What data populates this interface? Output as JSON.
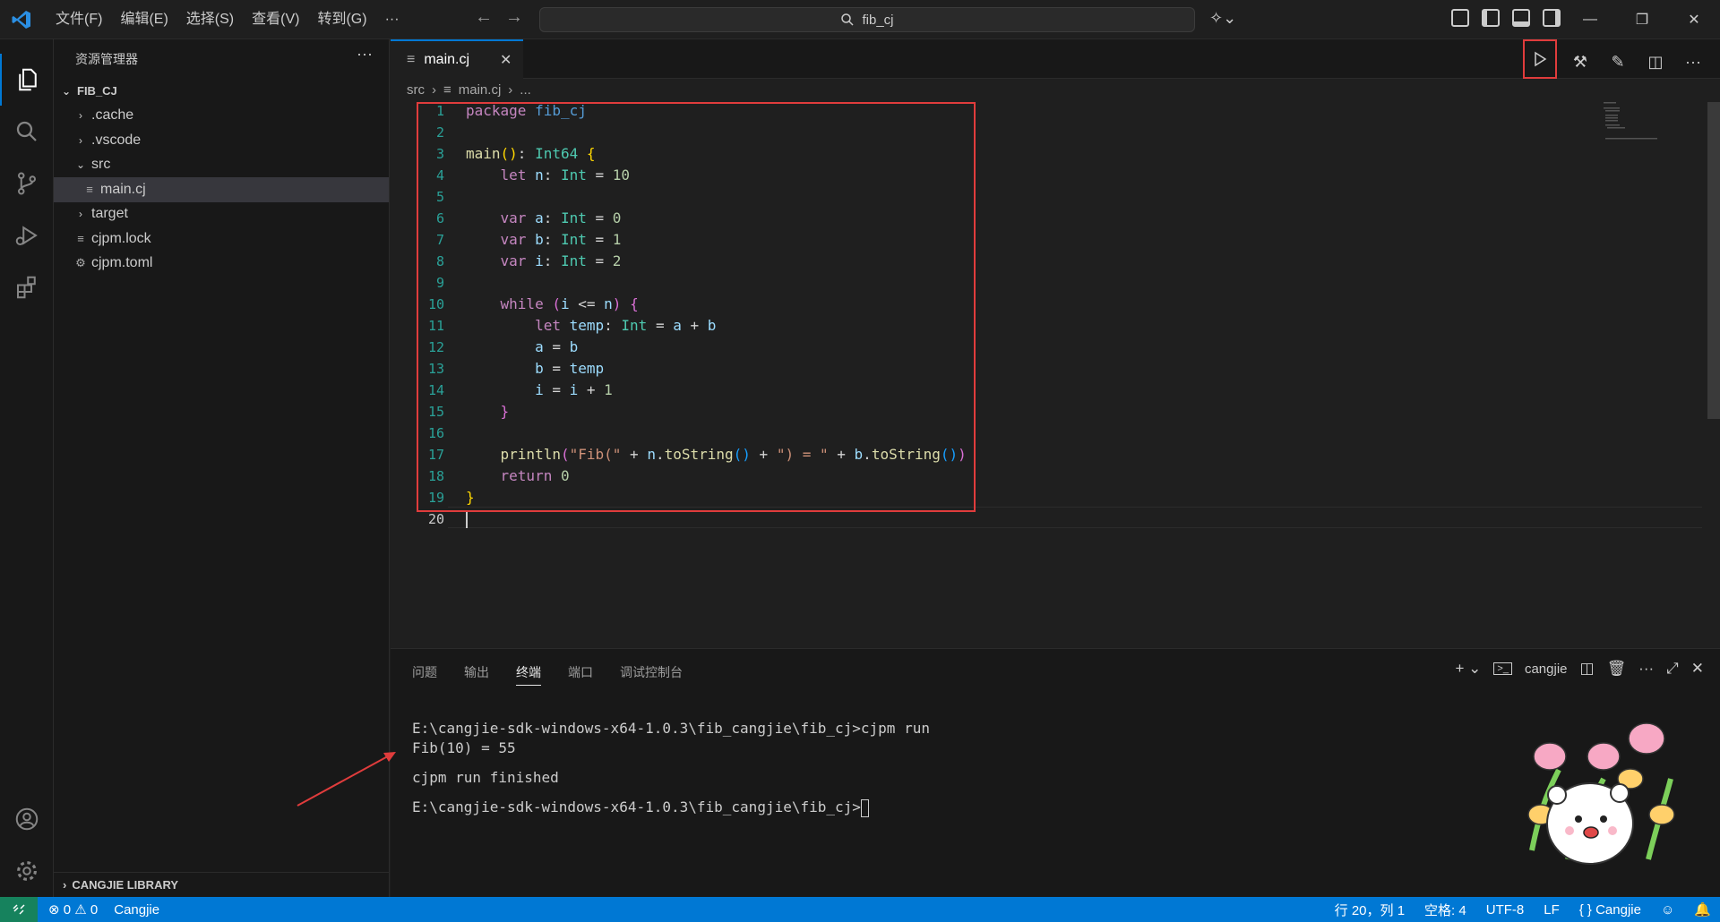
{
  "titlebar": {
    "menus": [
      "文件(F)",
      "编辑(E)",
      "选择(S)",
      "查看(V)",
      "转到(G)",
      "···"
    ],
    "search_text": "fib_cj"
  },
  "sidebar": {
    "title": "资源管理器",
    "more": "···",
    "root": "FIB_CJ",
    "items": [
      {
        "label": ".cache",
        "type": "folder",
        "expanded": false,
        "depth": 1
      },
      {
        "label": ".vscode",
        "type": "folder",
        "expanded": false,
        "depth": 1
      },
      {
        "label": "src",
        "type": "folder",
        "expanded": true,
        "depth": 1
      },
      {
        "label": "main.cj",
        "type": "file",
        "depth": 2,
        "selected": true
      },
      {
        "label": "target",
        "type": "folder",
        "expanded": false,
        "depth": 1
      },
      {
        "label": "cjpm.lock",
        "type": "file",
        "depth": 1
      },
      {
        "label": "cjpm.toml",
        "type": "gear-file",
        "depth": 1
      }
    ],
    "library_section": "CANGJIE LIBRARY"
  },
  "editor": {
    "tab_label": "main.cj",
    "breadcrumb": [
      "src",
      "main.cj",
      "..."
    ],
    "current_line": 20
  },
  "code_lines": [
    "package fib_cj",
    "",
    "main(): Int64 {",
    "    let n: Int = 10",
    "",
    "    var a: Int = 0",
    "    var b: Int = 1",
    "    var i: Int = 2",
    "",
    "    while (i <= n) {",
    "        let temp: Int = a + b",
    "        a = b",
    "        b = temp",
    "        i = i + 1",
    "    }",
    "",
    "    println(\"Fib(\" + n.toString() + \") = \" + b.toString())",
    "    return 0",
    "}",
    ""
  ],
  "panel": {
    "tabs": [
      "问题",
      "输出",
      "终端",
      "端口",
      "调试控制台"
    ],
    "active_tab": "终端",
    "terminal_name": "cangjie",
    "terminal_lines": [
      "E:\\cangjie-sdk-windows-x64-1.0.3\\fib_cangjie\\fib_cj>cjpm run",
      "Fib(10) = 55",
      "",
      "cjpm run finished",
      "",
      "E:\\cangjie-sdk-windows-x64-1.0.3\\fib_cangjie\\fib_cj>"
    ]
  },
  "statusbar": {
    "errors": "0",
    "warnings": "0",
    "language_left": "Cangjie",
    "position": "行 20，列 1",
    "spaces": "空格: 4",
    "encoding": "UTF-8",
    "eol": "LF",
    "language": "{ } Cangjie"
  },
  "colors": {
    "accent": "#0078d4",
    "highlight": "#e03c3c",
    "remote": "#16825d"
  }
}
